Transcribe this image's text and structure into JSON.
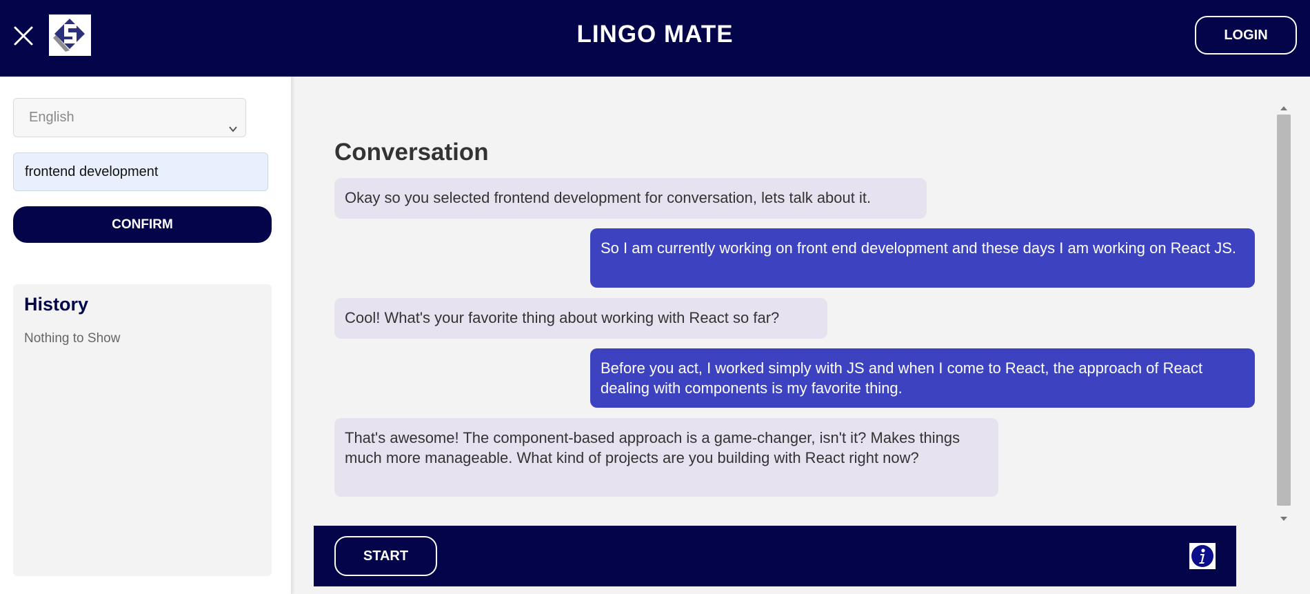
{
  "app": {
    "title": "LINGO MATE",
    "login_label": "LOGIN",
    "close_icon": "close-icon",
    "logo_icon": "logo-icon"
  },
  "sidebar": {
    "language": {
      "selected": "English",
      "icon": "chevron-down-icon"
    },
    "topic_input": {
      "value": "frontend development"
    },
    "confirm_label": "CONFIRM",
    "history": {
      "title": "History",
      "empty_text": "Nothing to Show"
    }
  },
  "conversation": {
    "title": "Conversation",
    "messages": [
      {
        "role": "bot",
        "text": "Okay so you selected frontend development for conversation, lets talk about it."
      },
      {
        "role": "user",
        "text": "So I am currently working on front end development and these days I am working on React JS."
      },
      {
        "role": "bot",
        "text": "Cool! What's your favorite thing about working with React so far?"
      },
      {
        "role": "user",
        "text": "Before you act, I worked simply with JS and when I come to React, the approach of React dealing with components is my favorite thing."
      },
      {
        "role": "bot",
        "text": "That's awesome! The component-based approach is a game-changer, isn't it? Makes things much more manageable. What kind of projects are you building with React right now?"
      }
    ]
  },
  "footer": {
    "start_label": "START",
    "info_icon": "info-icon"
  },
  "colors": {
    "header_bg": "#03044a",
    "user_bubble": "#3d43c0",
    "bot_bubble": "#e6e2f0",
    "page_bg": "#f3f3f3"
  }
}
